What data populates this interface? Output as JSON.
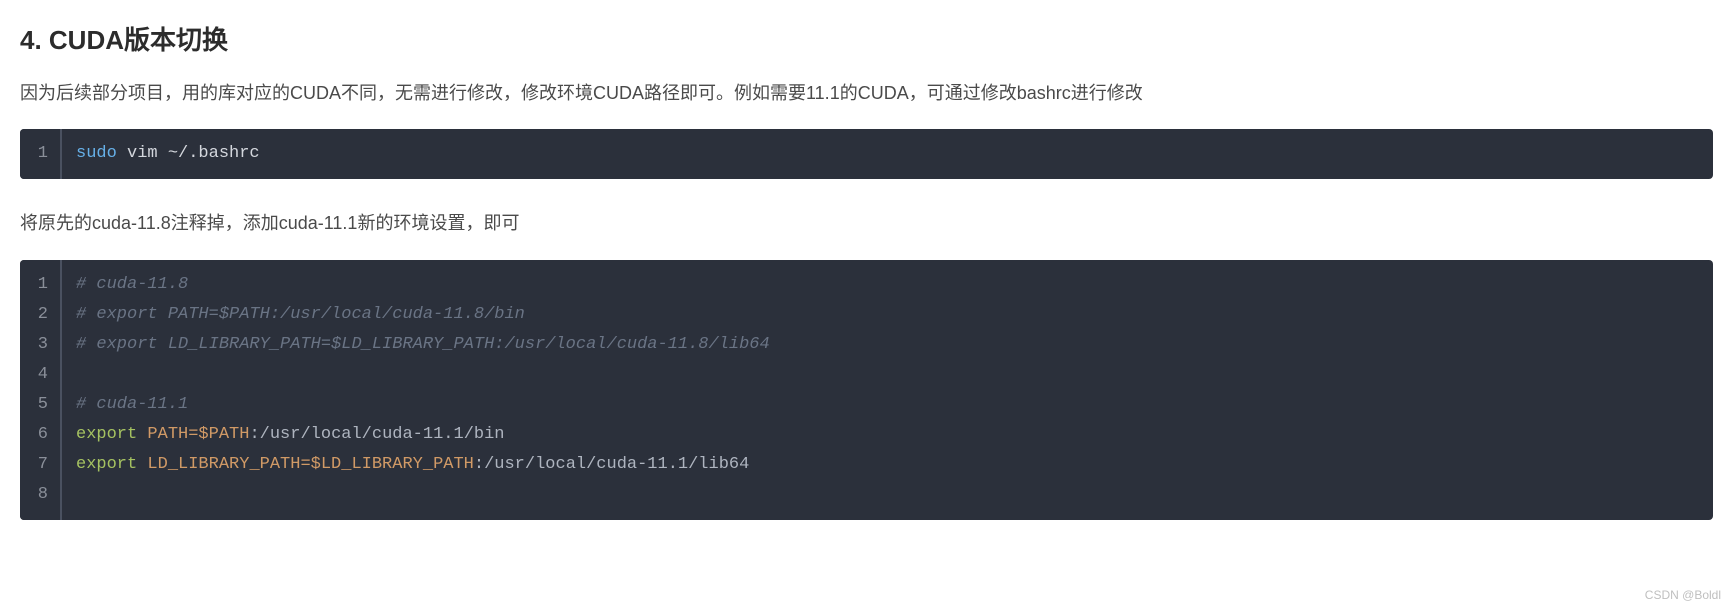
{
  "heading": "4. CUDA版本切换",
  "paragraph1": "因为后续部分项目，用的库对应的CUDA不同，无需进行修改，修改环境CUDA路径即可。例如需要11.1的CUDA，可通过修改bashrc进行修改",
  "paragraph2": "将原先的cuda-11.8注释掉，添加cuda-11.1新的环境设置，即可",
  "code1": {
    "lines": [
      {
        "num": "1",
        "tokens": [
          {
            "text": "sudo",
            "cls": "tok-keyword"
          },
          {
            "text": " vim ~/.bashrc",
            "cls": "tok-command"
          }
        ]
      }
    ]
  },
  "code2": {
    "lines": [
      {
        "num": "1",
        "tokens": [
          {
            "text": "# cuda-11.8",
            "cls": "tok-comment"
          }
        ]
      },
      {
        "num": "2",
        "tokens": [
          {
            "text": "# export PATH=$PATH:/usr/local/cuda-11.8/bin",
            "cls": "tok-comment"
          }
        ]
      },
      {
        "num": "3",
        "tokens": [
          {
            "text": "# export LD_LIBRARY_PATH=$LD_LIBRARY_PATH:/usr/local/cuda-11.8/lib64",
            "cls": "tok-comment"
          }
        ]
      },
      {
        "num": "4",
        "tokens": []
      },
      {
        "num": "5",
        "tokens": [
          {
            "text": "# cuda-11.1",
            "cls": "tok-comment"
          }
        ]
      },
      {
        "num": "6",
        "tokens": [
          {
            "text": "export",
            "cls": "tok-builtin"
          },
          {
            "text": " ",
            "cls": "tok-plain"
          },
          {
            "text": "PATH=$PATH",
            "cls": "tok-var"
          },
          {
            "text": ":/usr/local/cuda-11.1/bin",
            "cls": "tok-plain"
          }
        ]
      },
      {
        "num": "7",
        "tokens": [
          {
            "text": "export",
            "cls": "tok-builtin"
          },
          {
            "text": " ",
            "cls": "tok-plain"
          },
          {
            "text": "LD_LIBRARY_PATH=$LD_LIBRARY_PATH",
            "cls": "tok-var"
          },
          {
            "text": ":/usr/local/cuda-11.1/lib64",
            "cls": "tok-plain"
          }
        ]
      },
      {
        "num": "8",
        "tokens": []
      }
    ]
  },
  "watermark": "CSDN @Boldl"
}
